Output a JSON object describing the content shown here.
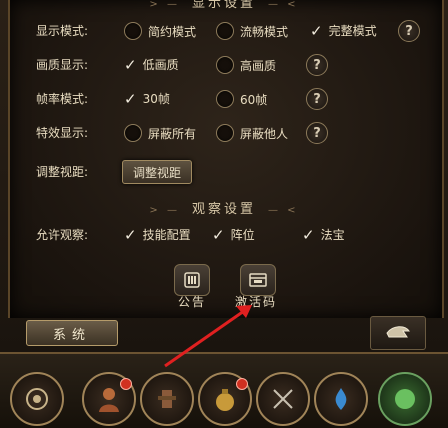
{
  "display_section": {
    "title": "显示设置"
  },
  "rows": {
    "display_mode": {
      "label": "显示模式:",
      "options": [
        "简约模式",
        "流畅模式",
        "完整模式"
      ],
      "selected": "完整模式"
    },
    "quality": {
      "label": "画质显示:",
      "options": [
        "低画质",
        "高画质"
      ],
      "selected": "低画质"
    },
    "frame_rate": {
      "label": "帧率模式:",
      "options": [
        "30帧",
        "60帧"
      ],
      "selected": "30帧"
    },
    "effects": {
      "label": "特效显示:",
      "options": [
        "屏蔽所有",
        "屏蔽他人"
      ],
      "selected": ""
    },
    "view_distance": {
      "label": "调整视距:",
      "button": "调整视距"
    }
  },
  "observe_section": {
    "title": "观察设置",
    "label": "允许观察:",
    "options": [
      "技能配置",
      "阵位",
      "法宝"
    ],
    "checked": [
      "技能配置",
      "阵位",
      "法宝"
    ]
  },
  "help_icon": "?",
  "icons": {
    "announcement": {
      "label": "公告",
      "icon": "announcement-icon"
    },
    "activation_code": {
      "label": "激活码",
      "icon": "activation-code-icon"
    }
  },
  "system_button": "系统",
  "colors": {
    "annotation_arrow": "#e02020",
    "accent_gold": "#b59b6a"
  }
}
